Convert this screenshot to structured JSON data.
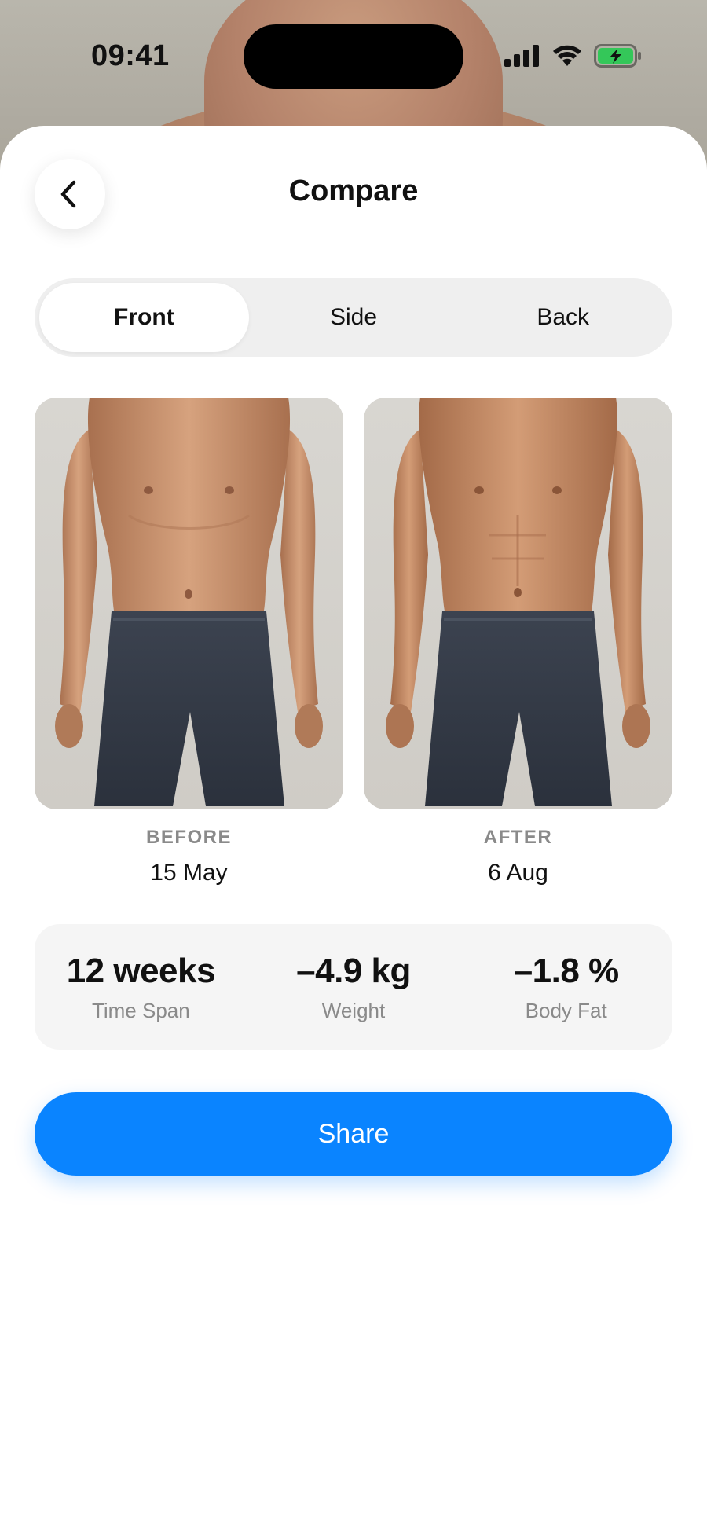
{
  "status_bar": {
    "time": "09:41"
  },
  "header": {
    "title": "Compare"
  },
  "tabs": [
    {
      "label": "Front",
      "active": true
    },
    {
      "label": "Side",
      "active": false
    },
    {
      "label": "Back",
      "active": false
    }
  ],
  "photos": {
    "before": {
      "label": "BEFORE",
      "date": "15 May"
    },
    "after": {
      "label": "AFTER",
      "date": "6 Aug"
    }
  },
  "stats": [
    {
      "value": "12 weeks",
      "label": "Time Span"
    },
    {
      "value": "–4.9 kg",
      "label": "Weight"
    },
    {
      "value": "–1.8 %",
      "label": "Body Fat"
    }
  ],
  "share": {
    "label": "Share"
  },
  "colors": {
    "accent": "#0a84ff",
    "battery": "#34c759",
    "segment_bg": "#efefef",
    "stats_bg": "#f5f5f5"
  },
  "icons": [
    "back-chevron-icon",
    "signal-icon",
    "wifi-icon",
    "battery-charging-icon"
  ]
}
